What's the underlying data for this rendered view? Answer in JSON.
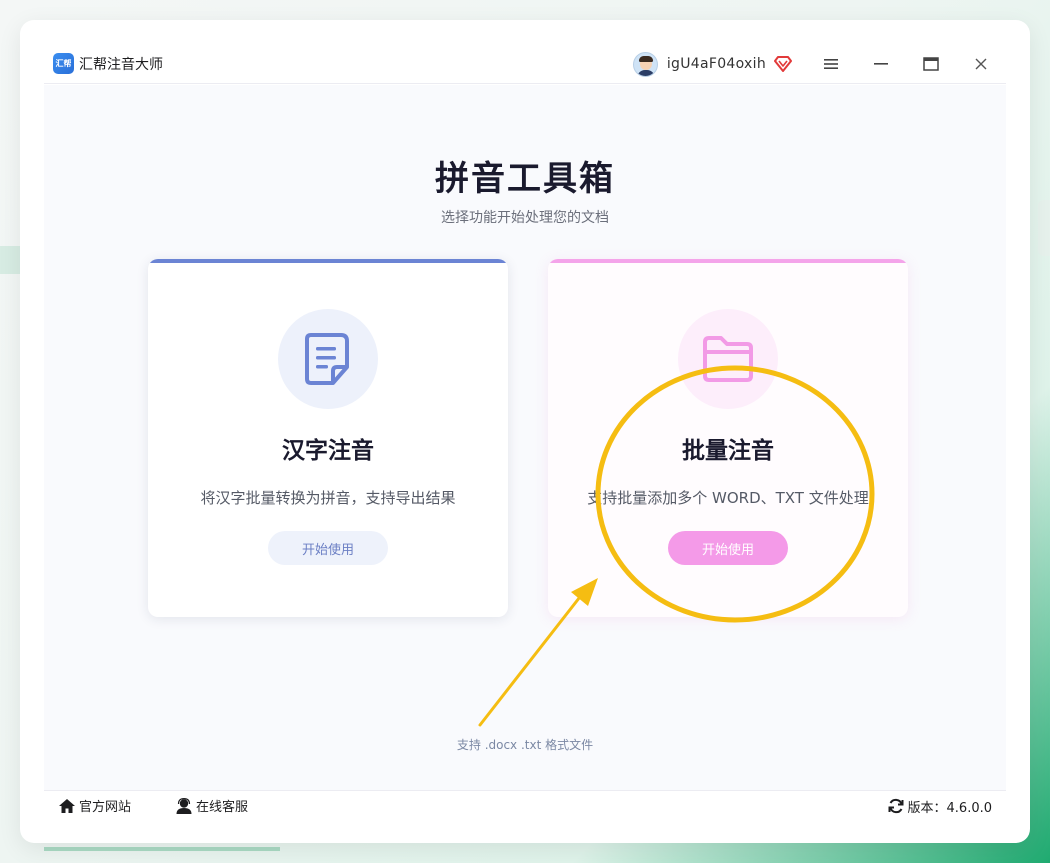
{
  "window": {
    "app_title": "汇帮注音大师",
    "app_logo_text": "汇帮",
    "username": "igU4aF04oxih",
    "icons": {
      "avatar": "user-avatar",
      "vip": "vip-diamond-icon",
      "menu": "hamburger-menu-icon",
      "minimize": "minimize-icon",
      "maximize": "maximize-icon",
      "close": "close-icon"
    }
  },
  "main": {
    "title": "拼音工具箱",
    "subtitle": "选择功能开始处理您的文档",
    "cards": [
      {
        "title": "汉字注音",
        "description": "将汉字批量转换为拼音，支持导出结果",
        "button_label": "开始使用",
        "icon": "document-icon",
        "accent": "#6b84d4"
      },
      {
        "title": "批量注音",
        "description": "支持批量添加多个 WORD、TXT 文件处理",
        "button_label": "开始使用",
        "icon": "folder-icon",
        "accent": "#f4a4ea"
      }
    ],
    "support_note": "支持 .docx .txt 格式文件"
  },
  "footer": {
    "official_site": "官方网站",
    "online_service": "在线客服",
    "version_label": "版本：4.6.0.0"
  },
  "colors": {
    "annotation": "#f5bd12",
    "primary_blue": "#6b84d4",
    "primary_pink": "#f49ae8"
  }
}
